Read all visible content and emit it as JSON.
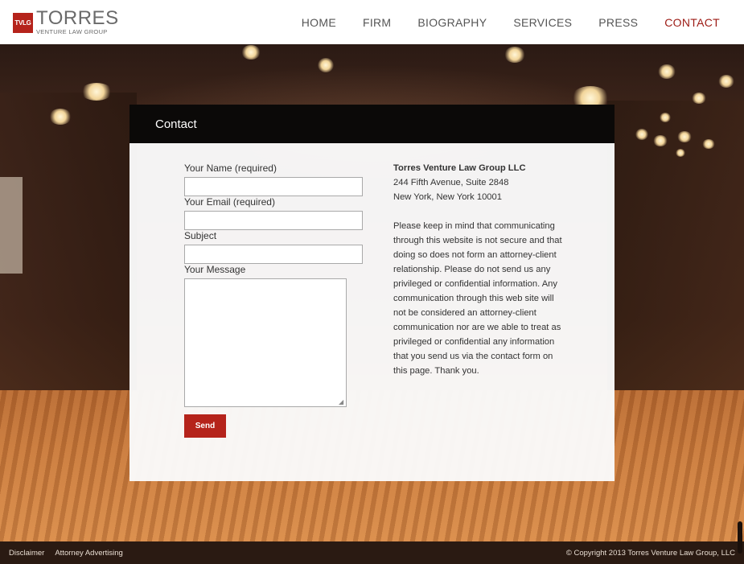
{
  "logo": {
    "mark": "TVLG",
    "name": "TORRES",
    "tagline": "VENTURE LAW GROUP"
  },
  "nav": {
    "items": [
      {
        "label": "HOME"
      },
      {
        "label": "FIRM"
      },
      {
        "label": "BIOGRAPHY"
      },
      {
        "label": "SERVICES"
      },
      {
        "label": "PRESS"
      },
      {
        "label": "CONTACT",
        "active": true
      }
    ]
  },
  "panel": {
    "title": "Contact"
  },
  "form": {
    "name_label": "Your Name (required)",
    "name_value": "",
    "email_label": "Your Email (required)",
    "email_value": "",
    "subject_label": "Subject",
    "subject_value": "",
    "message_label": "Your Message",
    "message_value": "",
    "send_label": "Send"
  },
  "info": {
    "firm": "Torres Venture Law Group LLC",
    "address1": "244 Fifth Avenue, Suite 2848",
    "address2": "New York, New York 10001",
    "notice": "Please keep in mind that communicating through this website is not secure and that doing so does not form an attorney-client relationship. Please do not send us any privileged or confidential information. Any communication through this web site will not be considered an attorney-client communication nor are we able to treat as privileged or confidential any information that you send us via the contact form on this page. Thank you."
  },
  "footer": {
    "disclaimer": "Disclaimer",
    "advertising": "Attorney Advertising",
    "copyright": "© Copyright 2013 Torres Venture Law Group, LLC"
  },
  "colors": {
    "accent": "#b5231b",
    "nav_active": "#9c1a14",
    "panel_header": "#0b0908"
  }
}
